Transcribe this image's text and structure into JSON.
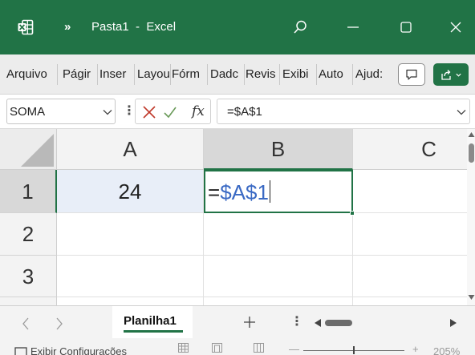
{
  "colors": {
    "brand": "#217346",
    "ref_blue": "#3b6ac4"
  },
  "titlebar": {
    "app_icon": "excel-icon",
    "more_glyph": "»",
    "title": "Pasta1  -  Excel",
    "buttons": [
      "search-icon",
      "minimize-icon",
      "maximize-icon",
      "close-icon"
    ]
  },
  "ribbon": {
    "tabs": [
      "Arquivo",
      "Págir",
      "Inser",
      "Layou",
      "Fórm",
      "Dadc",
      "Revis",
      "Exibi",
      "Auto",
      "Ajud:"
    ],
    "comment_icon": "comment-icon",
    "share_icon": "share-icon"
  },
  "formula_bar": {
    "name_box": "SOMA",
    "cancel_icon": "cancel-x-icon",
    "enter_icon": "checkmark-icon",
    "fx_label": "fx",
    "formula": "=$A$1"
  },
  "grid": {
    "columns": [
      "A",
      "B",
      "C"
    ],
    "rows": [
      "1",
      "2",
      "3"
    ],
    "cells": {
      "A1": "24"
    },
    "editor": {
      "prefix": "=",
      "ref": "$A$1"
    }
  },
  "sheets": {
    "nav_prev": "chevron-left-icon",
    "nav_next": "chevron-right-icon",
    "active": "Planilha1",
    "add_icon": "plus-icon"
  },
  "status": {
    "label": "Exibir Configurações",
    "zoom_minus": "—",
    "zoom_plus": "+",
    "zoom": "205%"
  }
}
